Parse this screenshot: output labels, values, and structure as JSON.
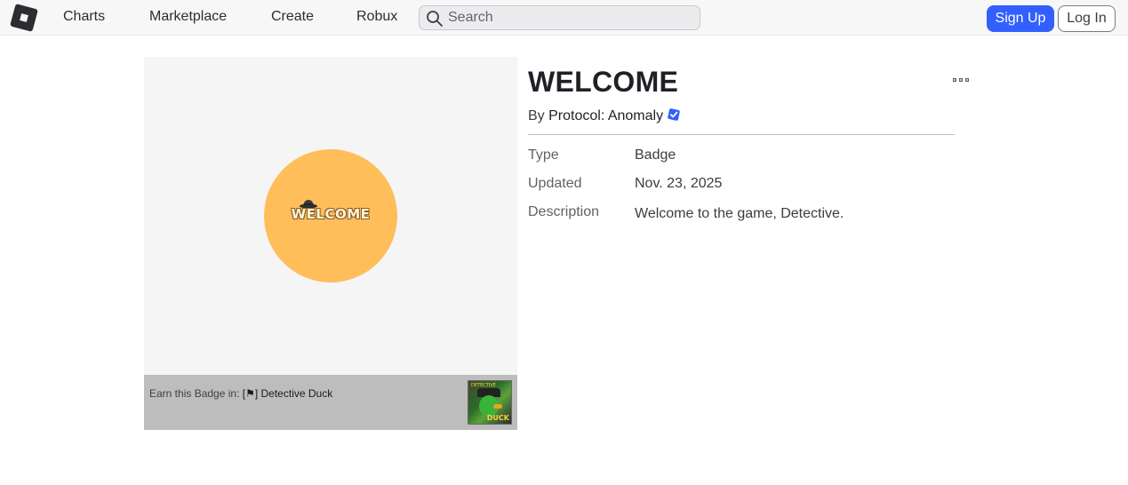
{
  "nav": {
    "links": [
      "Charts",
      "Marketplace",
      "Create",
      "Robux"
    ],
    "search_placeholder": "Search",
    "signup_label": "Sign Up",
    "login_label": "Log In",
    "logo_icon": "roblox-logo-icon"
  },
  "badge_image": {
    "badge_text": "WELCOME",
    "badge_color": "#ffbe5a",
    "earn_prefix": "Earn this Badge in:",
    "earn_game": "[⚑] Detective Duck",
    "game_thumb_top_text": "DETECTIVE",
    "game_thumb_tag": "DUCK"
  },
  "details": {
    "title": "WELCOME",
    "by_prefix": "By",
    "creator": "Protocol: Anomaly",
    "verified_color": "#335fff",
    "rows": [
      {
        "label": "Type",
        "value": "Badge"
      },
      {
        "label": "Updated",
        "value": "Nov. 23, 2025"
      },
      {
        "label": "Description",
        "value": "Welcome to the game, Detective."
      }
    ]
  },
  "colors": {
    "accent": "#335fff",
    "panel_bg": "#f5f5f5",
    "earn_bar": "#bdbdbd"
  }
}
